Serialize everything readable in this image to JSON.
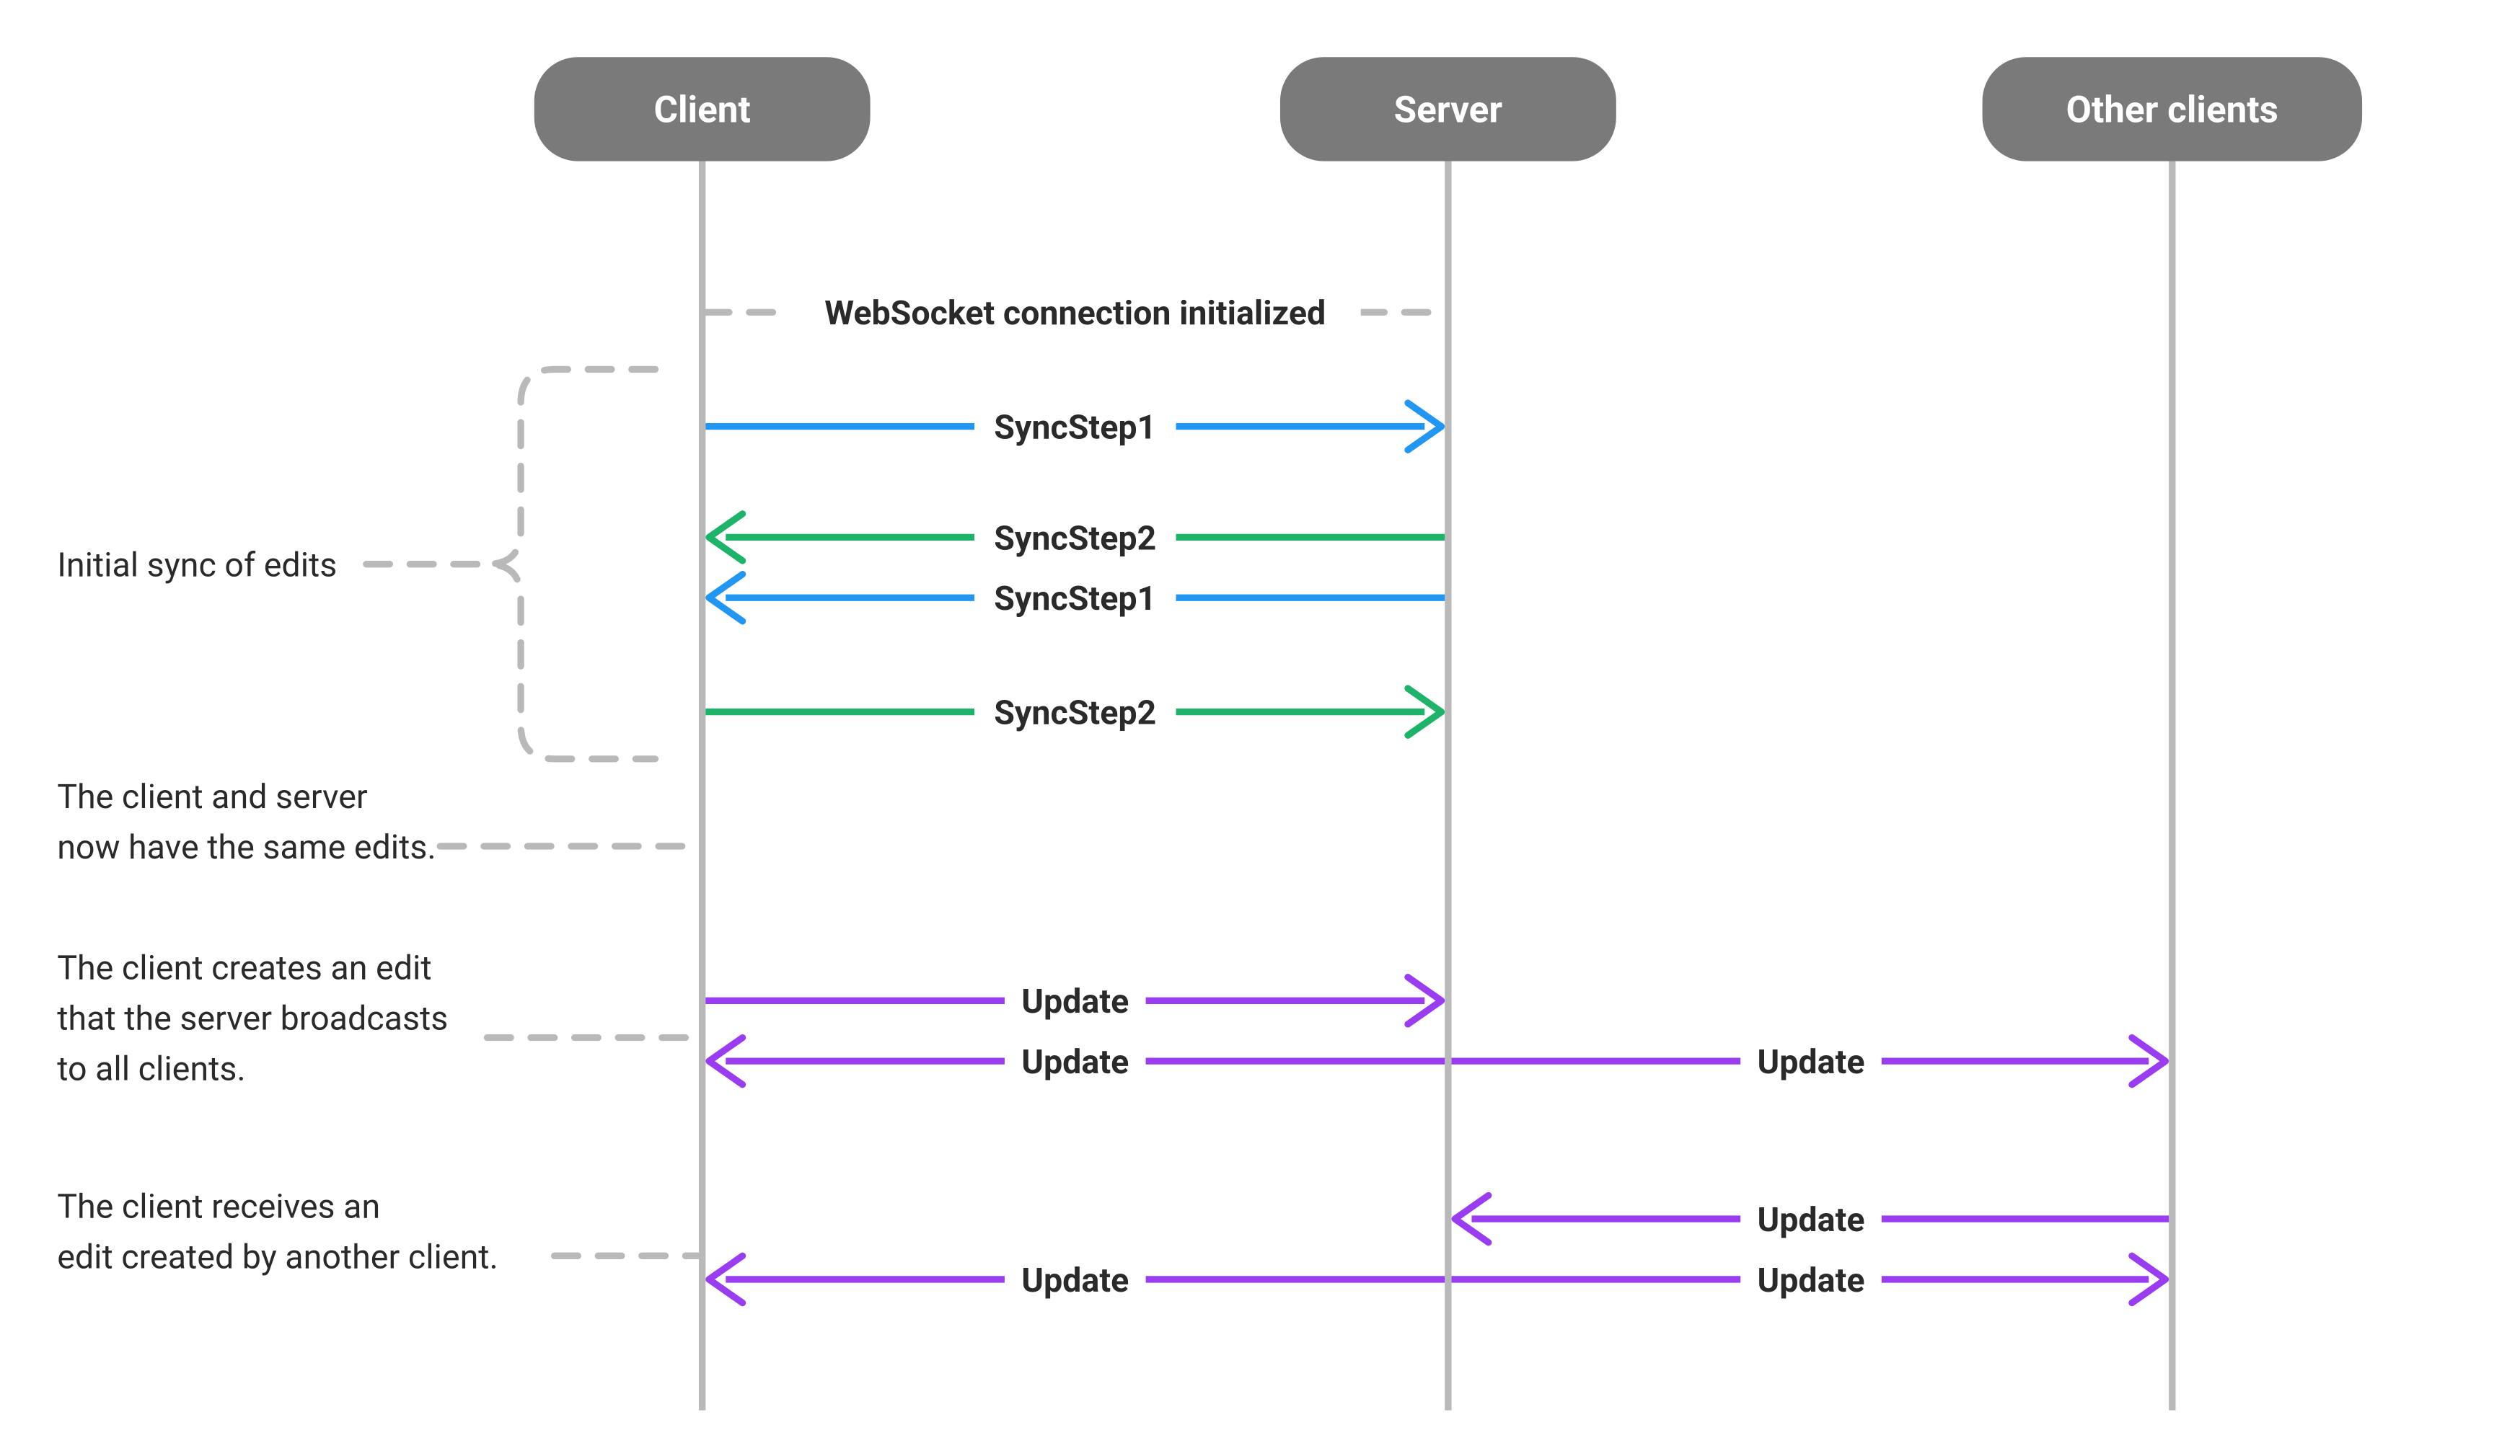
{
  "colors": {
    "blue": "#2196f3",
    "green": "#1db46a",
    "purple": "#9a3cf0",
    "grey": "#b9b9b9",
    "pill": "#7a7a7a",
    "text": "#2a2a2a"
  },
  "participants": {
    "client": "Client",
    "server": "Server",
    "others": "Other clients"
  },
  "notes": {
    "ws_init": "WebSocket connection initialized",
    "initial_sync": "Initial sync of edits",
    "same_edits_l1": "The client and server",
    "same_edits_l2": "now have the same edits.",
    "client_edit_l1": "The client creates an edit",
    "client_edit_l2": "that the server broadcasts",
    "client_edit_l3": "to all clients.",
    "recv_edit_l1": "The client receives an",
    "recv_edit_l2": "edit created by another client."
  },
  "messages": {
    "sync1": "SyncStep1",
    "sync2": "SyncStep2",
    "update": "Update"
  },
  "chart_data": {
    "type": "sequence-diagram",
    "participants": [
      "Client",
      "Server",
      "Other clients"
    ],
    "phases": [
      {
        "label": "WebSocket connection initialized",
        "type": "divider",
        "between": [
          "Client",
          "Server"
        ]
      },
      {
        "label": "Initial sync of edits",
        "messages": [
          {
            "from": "Client",
            "to": "Server",
            "label": "SyncStep1",
            "color": "blue"
          },
          {
            "from": "Server",
            "to": "Client",
            "label": "SyncStep2",
            "color": "green"
          },
          {
            "from": "Server",
            "to": "Client",
            "label": "SyncStep1",
            "color": "blue"
          },
          {
            "from": "Client",
            "to": "Server",
            "label": "SyncStep2",
            "color": "green"
          }
        ]
      },
      {
        "label": "The client and server now have the same edits.",
        "type": "note"
      },
      {
        "label": "The client creates an edit that the server broadcasts to all clients.",
        "messages": [
          {
            "from": "Client",
            "to": "Server",
            "label": "Update",
            "color": "purple"
          },
          {
            "from": "Server",
            "to": "Client",
            "label": "Update",
            "color": "purple"
          },
          {
            "from": "Server",
            "to": "Other clients",
            "label": "Update",
            "color": "purple"
          }
        ]
      },
      {
        "label": "The client receives an edit created by another client.",
        "messages": [
          {
            "from": "Other clients",
            "to": "Server",
            "label": "Update",
            "color": "purple"
          },
          {
            "from": "Server",
            "to": "Client",
            "label": "Update",
            "color": "purple"
          },
          {
            "from": "Server",
            "to": "Other clients",
            "label": "Update",
            "color": "purple"
          }
        ]
      }
    ]
  }
}
